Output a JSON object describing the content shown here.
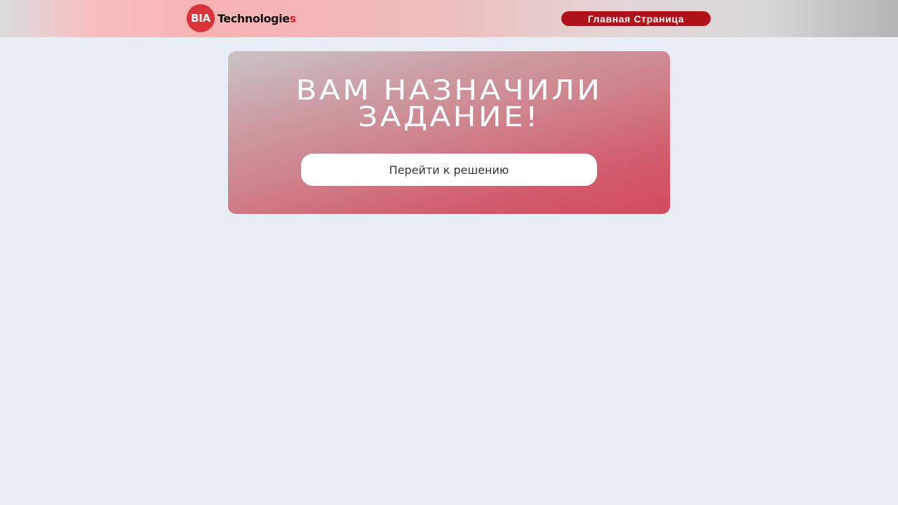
{
  "header": {
    "logo": {
      "badge_text": "BIA",
      "text_main": "Technologie",
      "text_accent": "s"
    },
    "home_button_label": "Главная Страница"
  },
  "card": {
    "title_line1": "ВАМ НАЗНАЧИЛИ",
    "title_line2": "ЗАДАНИЕ!",
    "button_label": "Перейти к решению"
  },
  "colors": {
    "page_background": "#e9edf4",
    "brand_red": "#d8343a",
    "home_button": "#b0121a",
    "card_gradient_start": "#c8c5c5",
    "card_gradient_end": "#d24b5d"
  }
}
